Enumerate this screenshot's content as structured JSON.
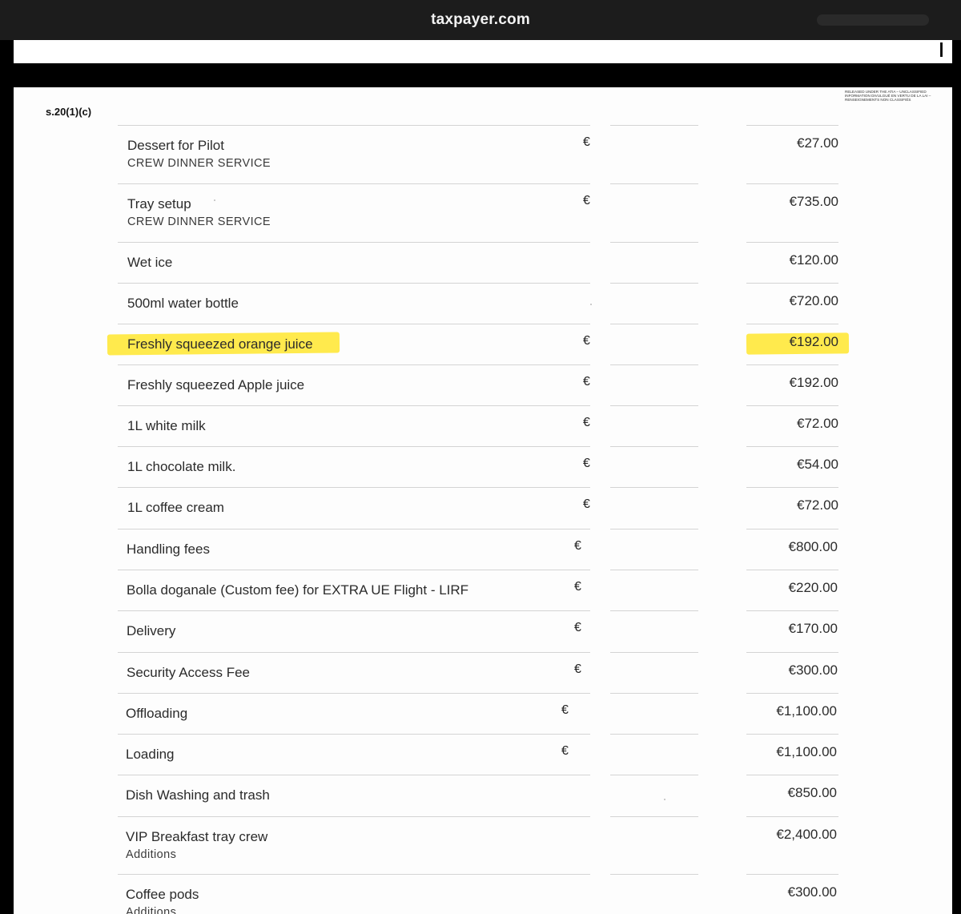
{
  "browser": {
    "site": "taxpayer.com"
  },
  "document": {
    "reference": "s.20(1)(c)",
    "release_stamp": "RELEASED UNDER THE ATIA – UNCLASSIFIED INFORMATION DIVULGUÉ EN VERTU DE LA LAI – RENSEIGNEMENTS NON CLASSIFIÉS",
    "items": [
      {
        "name": "Dessert for Pilot",
        "sub": "CREW DINNER SERVICE",
        "currency": "€",
        "amount": "€27.00"
      },
      {
        "name": "Tray setup",
        "sub": "CREW DINNER SERVICE",
        "currency": "€",
        "amount": "€735.00"
      },
      {
        "name": "Wet ice",
        "sub": "",
        "currency": "",
        "amount": "€120.00"
      },
      {
        "name": "500ml water bottle",
        "sub": "",
        "currency": "",
        "amount": "€720.00"
      },
      {
        "name": "Freshly squeezed orange juice",
        "sub": "",
        "currency": "€",
        "amount": "€192.00",
        "highlighted": true
      },
      {
        "name": "Freshly squeezed Apple juice",
        "sub": "",
        "currency": "€",
        "amount": "€192.00"
      },
      {
        "name": "1L white milk",
        "sub": "",
        "currency": "€",
        "amount": "€72.00"
      },
      {
        "name": "1L chocolate milk.",
        "sub": "",
        "currency": "€",
        "amount": "€54.00"
      },
      {
        "name": "1L coffee cream",
        "sub": "",
        "currency": "€",
        "amount": "€72.00"
      },
      {
        "name": "Handling fees",
        "sub": "",
        "currency": "€",
        "amount": "€800.00"
      },
      {
        "name": "Bolla doganale (Custom fee) for EXTRA UE Flight - LIRF",
        "sub": "",
        "currency": "€",
        "amount": "€220.00"
      },
      {
        "name": "Delivery",
        "sub": "",
        "currency": "€",
        "amount": "€170.00"
      },
      {
        "name": "Security Access Fee",
        "sub": "",
        "currency": "€",
        "amount": "€300.00"
      },
      {
        "name": "Offloading",
        "sub": "",
        "currency": "€",
        "amount": "€1,100.00"
      },
      {
        "name": "Loading",
        "sub": "",
        "currency": "€",
        "amount": "€1,100.00"
      },
      {
        "name": "Dish Washing and trash",
        "sub": "",
        "currency": "",
        "amount": "€850.00"
      },
      {
        "name": "VIP Breakfast tray crew",
        "sub": "Additions",
        "currency": "",
        "amount": "€2,400.00"
      },
      {
        "name": "Coffee pods",
        "sub": "Additions",
        "currency": "",
        "amount": "€300.00"
      }
    ],
    "colors": {
      "highlight": "#ffe62e",
      "page": "#fdfdfd",
      "frame": "#000000"
    }
  }
}
